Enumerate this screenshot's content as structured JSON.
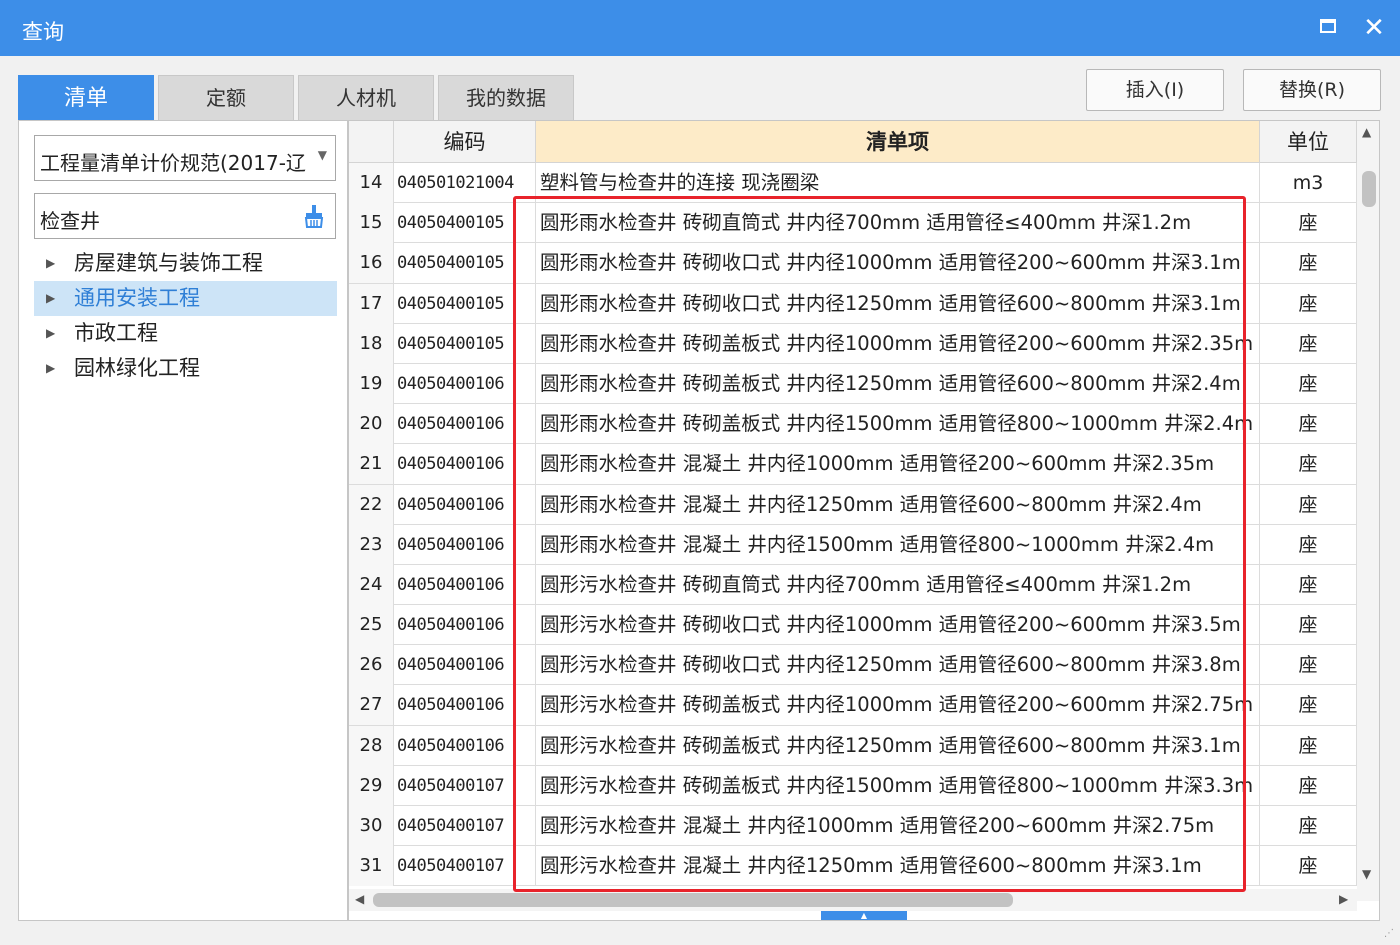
{
  "window": {
    "title": "查询",
    "maximize_icon": "maximize-icon",
    "close_icon": "close-icon",
    "close_glyph": "✕"
  },
  "tabs": [
    {
      "label": "清单",
      "active": true
    },
    {
      "label": "定额",
      "active": false
    },
    {
      "label": "人材机",
      "active": false
    },
    {
      "label": "我的数据",
      "active": false
    }
  ],
  "actions": {
    "insert_label": "插入(I)",
    "replace_label": "替换(R)"
  },
  "left": {
    "spec_select": "工程量清单计价规范(2017-辽",
    "search_value": "检查井",
    "tree": [
      {
        "label": "房屋建筑与装饰工程",
        "selected": false
      },
      {
        "label": "通用安装工程",
        "selected": true
      },
      {
        "label": "市政工程",
        "selected": false
      },
      {
        "label": "园林绿化工程",
        "selected": false
      }
    ]
  },
  "grid": {
    "columns": {
      "code": "编码",
      "item": "清单项",
      "unit": "单位"
    },
    "rows": [
      {
        "num": "14",
        "code": "040501021004",
        "item": "塑料管与检查井的连接 现浇圈梁",
        "unit": "m3"
      },
      {
        "num": "15",
        "code": "04050400105",
        "item": "圆形雨水检查井 砖砌直筒式 井内径700mm 适用管径≤400mm 井深1.2m",
        "unit": "座"
      },
      {
        "num": "16",
        "code": "04050400105",
        "item": "圆形雨水检查井 砖砌收口式 井内径1000mm 适用管径200~600mm 井深3.1m",
        "unit": "座"
      },
      {
        "num": "17",
        "code": "04050400105",
        "item": "圆形雨水检查井 砖砌收口式 井内径1250mm 适用管径600~800mm 井深3.1m",
        "unit": "座"
      },
      {
        "num": "18",
        "code": "04050400105",
        "item": "圆形雨水检查井 砖砌盖板式 井内径1000mm 适用管径200~600mm 井深2.35m",
        "unit": "座"
      },
      {
        "num": "19",
        "code": "04050400106",
        "item": "圆形雨水检查井 砖砌盖板式 井内径1250mm 适用管径600~800mm 井深2.4m",
        "unit": "座"
      },
      {
        "num": "20",
        "code": "04050400106",
        "item": "圆形雨水检查井 砖砌盖板式 井内径1500mm 适用管径800~1000mm 井深2.4m",
        "unit": "座"
      },
      {
        "num": "21",
        "code": "04050400106",
        "item": "圆形雨水检查井 混凝土 井内径1000mm 适用管径200~600mm 井深2.35m",
        "unit": "座"
      },
      {
        "num": "22",
        "code": "04050400106",
        "item": "圆形雨水检查井 混凝土 井内径1250mm 适用管径600~800mm 井深2.4m",
        "unit": "座"
      },
      {
        "num": "23",
        "code": "04050400106",
        "item": "圆形雨水检查井 混凝土 井内径1500mm 适用管径800~1000mm 井深2.4m",
        "unit": "座"
      },
      {
        "num": "24",
        "code": "04050400106",
        "item": "圆形污水检查井 砖砌直筒式 井内径700mm 适用管径≤400mm 井深1.2m",
        "unit": "座"
      },
      {
        "num": "25",
        "code": "04050400106",
        "item": "圆形污水检查井 砖砌收口式 井内径1000mm 适用管径200~600mm 井深3.5m",
        "unit": "座"
      },
      {
        "num": "26",
        "code": "04050400106",
        "item": "圆形污水检查井 砖砌收口式 井内径1250mm 适用管径600~800mm 井深3.8m",
        "unit": "座"
      },
      {
        "num": "27",
        "code": "04050400106",
        "item": "圆形污水检查井 砖砌盖板式 井内径1000mm 适用管径200~600mm 井深2.75m",
        "unit": "座"
      },
      {
        "num": "28",
        "code": "04050400106",
        "item": "圆形污水检查井 砖砌盖板式 井内径1250mm 适用管径600~800mm 井深3.1m",
        "unit": "座"
      },
      {
        "num": "29",
        "code": "04050400107",
        "item": "圆形污水检查井 砖砌盖板式 井内径1500mm 适用管径800~1000mm 井深3.3m",
        "unit": "座"
      },
      {
        "num": "30",
        "code": "04050400107",
        "item": "圆形污水检查井 混凝土 井内径1000mm 适用管径200~600mm 井深2.75m",
        "unit": "座"
      },
      {
        "num": "31",
        "code": "04050400107",
        "item": "圆形污水检查井 混凝土 井内径1250mm 适用管径600~800mm 井深3.1m",
        "unit": "座"
      }
    ]
  },
  "colors": {
    "accent": "#3d8ee8",
    "header_highlight": "#fdebc8",
    "annotation": "#e8232b"
  }
}
